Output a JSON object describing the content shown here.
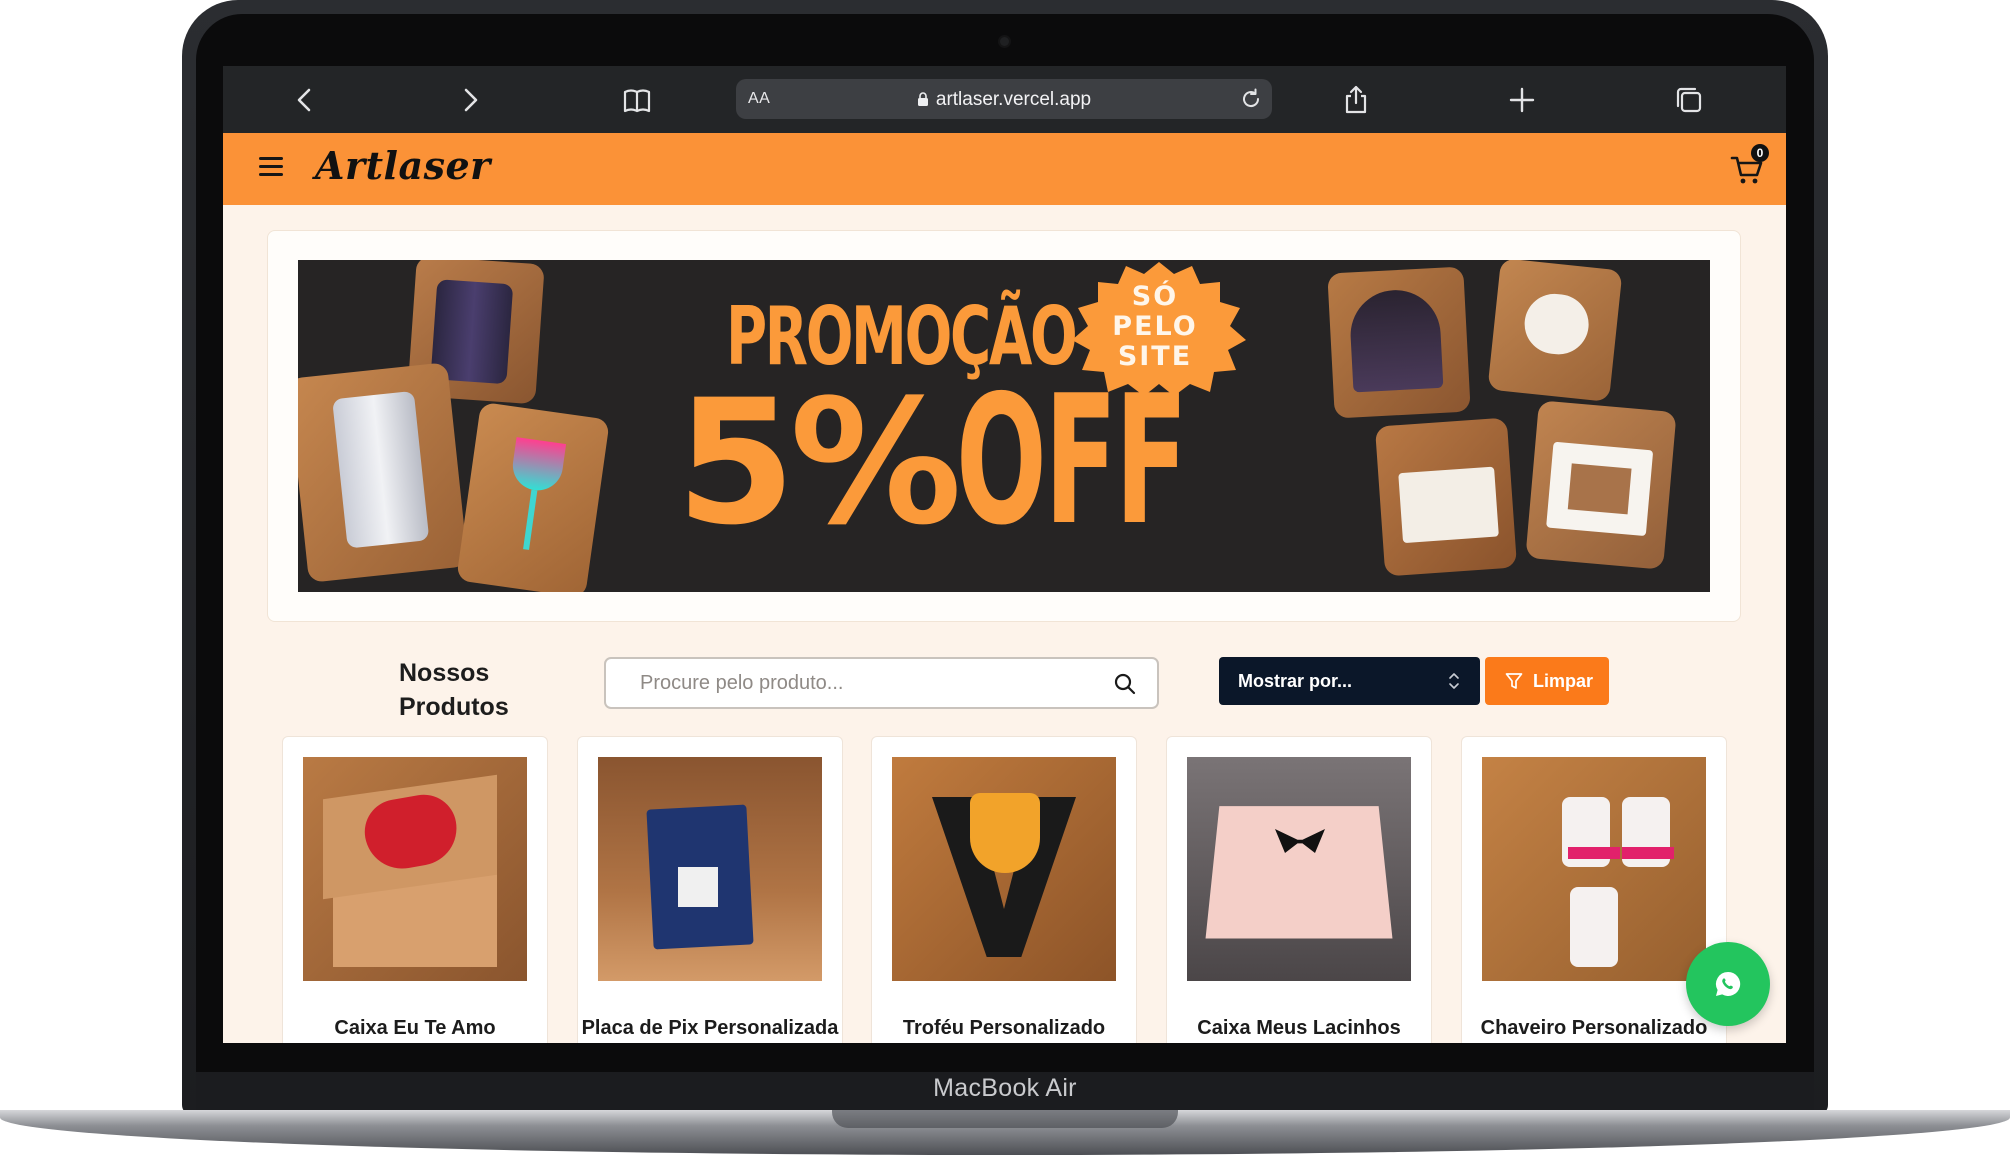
{
  "device": {
    "label": "MacBook Air"
  },
  "browser": {
    "text_size_label": "AA",
    "url": "artlaser.vercel.app"
  },
  "site": {
    "logo": "Artlaser",
    "cart_count": "0"
  },
  "banner": {
    "headline": "PROMOÇÃO",
    "discount": "5%",
    "discount_suffix": "OFF",
    "badge_line1": "SÓ",
    "badge_line2": "PELO",
    "badge_line3": "SITE",
    "accent_color": "#fb9a3a"
  },
  "products_section": {
    "title_line1": "Nossos",
    "title_line2": "Produtos",
    "search_placeholder": "Procure pelo produto...",
    "sort_label": "Mostrar por...",
    "clear_label": "Limpar"
  },
  "products": [
    {
      "name": "Caixa Eu Te Amo"
    },
    {
      "name": "Placa de Pix Personalizada"
    },
    {
      "name": "Troféu Personalizado"
    },
    {
      "name": "Caixa Meus Lacinhos"
    },
    {
      "name": "Chaveiro Personalizado"
    }
  ],
  "colors": {
    "header": "#fb9237",
    "clear_button": "#fb7a1a",
    "sort_button": "#0b1729",
    "whatsapp": "#23c55e"
  }
}
